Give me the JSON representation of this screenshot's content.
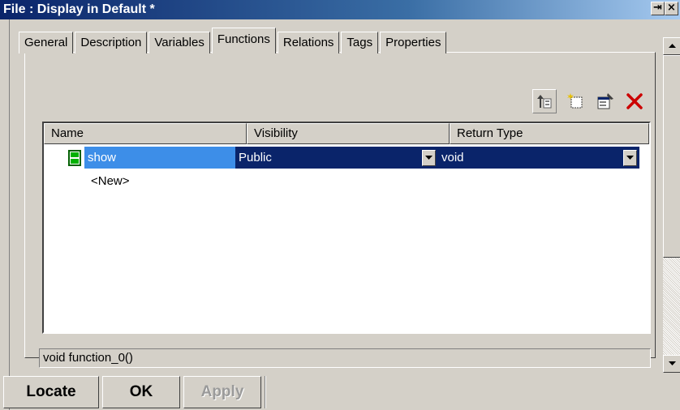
{
  "window": {
    "title": "File : Display in Default *"
  },
  "tabs": [
    {
      "label": "General",
      "active": false
    },
    {
      "label": "Description",
      "active": false
    },
    {
      "label": "Variables",
      "active": false
    },
    {
      "label": "Functions",
      "active": true
    },
    {
      "label": "Relations",
      "active": false
    },
    {
      "label": "Tags",
      "active": false
    },
    {
      "label": "Properties",
      "active": false
    }
  ],
  "toolbar": {
    "icons": [
      "move-up-icon",
      "new-item-icon",
      "properties-icon",
      "delete-icon"
    ]
  },
  "grid": {
    "columns": [
      "Name",
      "Visibility",
      "Return Type"
    ],
    "rows": [
      {
        "name": "show",
        "visibility": "Public",
        "return_type": "void",
        "selected": true
      },
      {
        "name": "<New>",
        "visibility": "",
        "return_type": "",
        "selected": false
      }
    ]
  },
  "status": {
    "text": "void function_0()"
  },
  "buttons": {
    "locate": "Locate",
    "ok": "OK",
    "apply": "Apply"
  },
  "colors": {
    "selection": "#0a246a",
    "name_selection": "#3d8ee8",
    "delete_red": "#cc0000"
  }
}
